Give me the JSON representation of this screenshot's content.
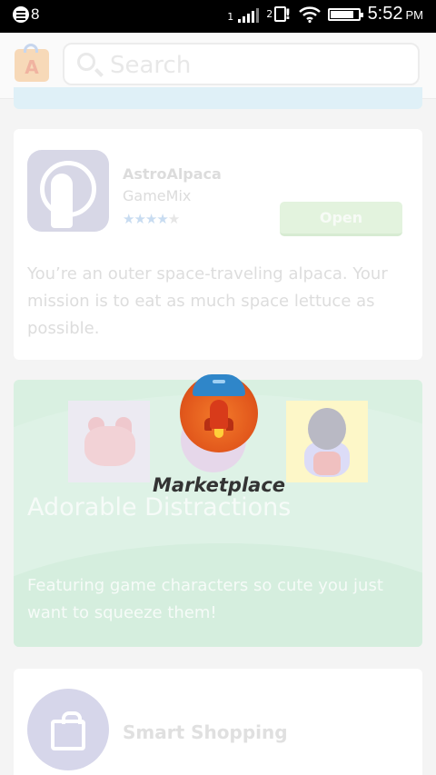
{
  "status_bar": {
    "notification_count": "8",
    "sim1_label": "1",
    "sim2_label": "2",
    "alert": "!",
    "time": "5:52",
    "ampm": "PM"
  },
  "header": {
    "search_placeholder": "Search",
    "logo_letter": "A"
  },
  "featured_app": {
    "name": "AstroAlpaca",
    "developer": "GameMix",
    "rating_stars": 4,
    "rating_max": 5,
    "action_label": "Open",
    "description": "You’re an outer space-traveling alpaca. Your mission is to eat as much space lettuce as possible."
  },
  "collection": {
    "title": "Adorable Distractions",
    "description": "Featuring game characters so cute you just want to squeeze them!"
  },
  "next_card": {
    "title": "Smart Shopping"
  },
  "overlay": {
    "label": "Marketplace"
  },
  "colors": {
    "accent_green": "#e3f3de",
    "feature_bg": "#d9f0e1",
    "rocket_orange": "#e2581c",
    "visor_blue": "#2f86c9"
  }
}
